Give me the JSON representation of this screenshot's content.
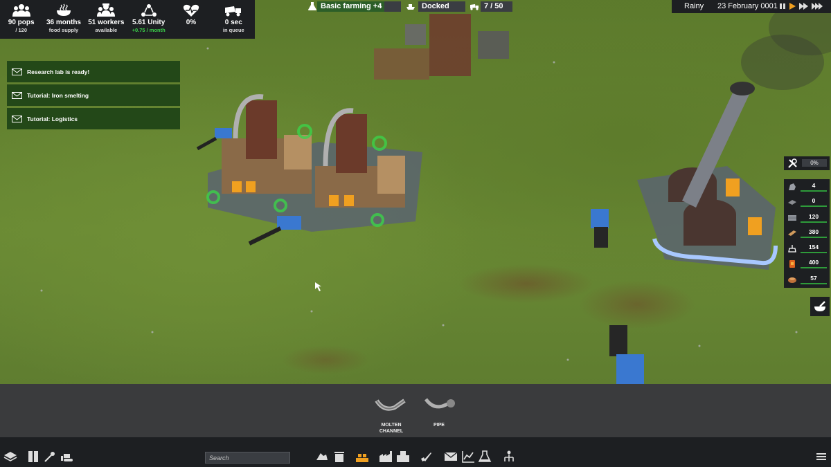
{
  "stats": [
    {
      "icon": "population-icon",
      "line1": "90 pops",
      "line2": "/ 120",
      "line2_color": "white"
    },
    {
      "icon": "food-bowl-icon",
      "line1": "36 months",
      "line2": "food supply",
      "line2_color": "white"
    },
    {
      "icon": "workers-icon",
      "line1": "51 workers",
      "line2": "available",
      "line2_color": "white"
    },
    {
      "icon": "unity-icon",
      "line1": "5.61 Unity",
      "line2": "+0.75 / month",
      "line2_color": "green"
    },
    {
      "icon": "health-heart-icon",
      "line1": "0%",
      "line2": "",
      "line2_color": "white"
    },
    {
      "icon": "truck-queue-icon",
      "line1": "0 sec",
      "line2": "in queue",
      "line2_color": "white"
    }
  ],
  "topbar": {
    "research": "Basic farming +4",
    "ship_status": "Docked",
    "vehicles": "7 / 50",
    "weather": "Rainy",
    "date": "23 February 0001"
  },
  "notifications": [
    {
      "text": "Research lab is ready!"
    },
    {
      "text": "Tutorial: Iron smelting"
    },
    {
      "text": "Tutorial: Logistics"
    }
  ],
  "maintenance": {
    "value": "0%"
  },
  "resources": [
    {
      "icon": "iron-ore-icon",
      "value": "4"
    },
    {
      "icon": "copper-ore-icon",
      "value": "0"
    },
    {
      "icon": "iron-icon",
      "value": "120"
    },
    {
      "icon": "wood-plank-icon",
      "value": "380"
    },
    {
      "icon": "construction-parts-icon",
      "value": "154"
    },
    {
      "icon": "diesel-icon",
      "value": "400"
    },
    {
      "icon": "potato-icon",
      "value": "57"
    }
  ],
  "tray": [
    {
      "line1": "MOLTEN",
      "line2": "CHANNEL"
    },
    {
      "line1": "PIPE",
      "line2": ""
    }
  ],
  "search": {
    "placeholder": "Search"
  },
  "colors": {
    "accent_green": "#3cd24a",
    "panel": "#1d1f22",
    "notification": "#234818",
    "toolbar_highlight": "#f0a020"
  }
}
